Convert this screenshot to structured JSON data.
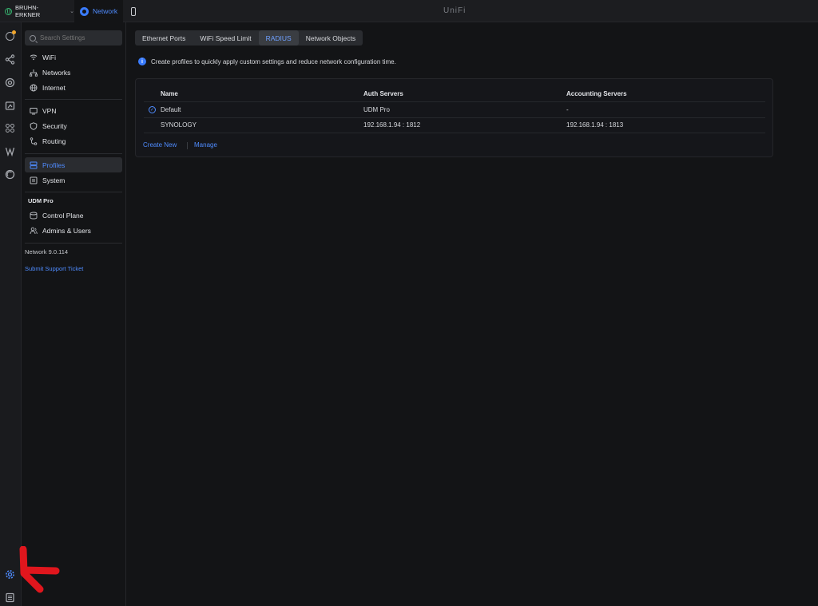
{
  "topbar": {
    "site_name": "BRUHN-ERKNER",
    "app_tab": "Network",
    "brand": "UniFi"
  },
  "sidebar": {
    "search_placeholder": "Search Settings",
    "items": [
      {
        "label": "WiFi"
      },
      {
        "label": "Networks"
      },
      {
        "label": "Internet"
      },
      {
        "label": "VPN"
      },
      {
        "label": "Security"
      },
      {
        "label": "Routing"
      },
      {
        "label": "Profiles"
      },
      {
        "label": "System"
      }
    ],
    "device_group": "UDM Pro",
    "device_items": [
      {
        "label": "Control Plane"
      },
      {
        "label": "Admins & Users"
      }
    ],
    "version": "Network 9.0.114",
    "support_link": "Submit Support Ticket"
  },
  "tabs": [
    {
      "label": "Ethernet Ports"
    },
    {
      "label": "WiFi Speed Limit"
    },
    {
      "label": "RADIUS"
    },
    {
      "label": "Network Objects"
    }
  ],
  "info_text": "Create profiles to quickly apply custom settings and reduce network configuration time.",
  "table": {
    "columns": [
      "Name",
      "Auth Servers",
      "Accounting Servers"
    ],
    "rows": [
      {
        "name": "Default",
        "auth": "UDM Pro",
        "accounting": "-"
      },
      {
        "name": "SYNOLOGY",
        "auth": "192.168.1.94 : 1812",
        "accounting": "192.168.1.94 : 1813"
      }
    ]
  },
  "actions": {
    "create_new": "Create New",
    "manage": "Manage"
  },
  "colors": {
    "accent": "#4f8cff",
    "background": "#131416",
    "annotation_arrow": "#e0161d"
  }
}
